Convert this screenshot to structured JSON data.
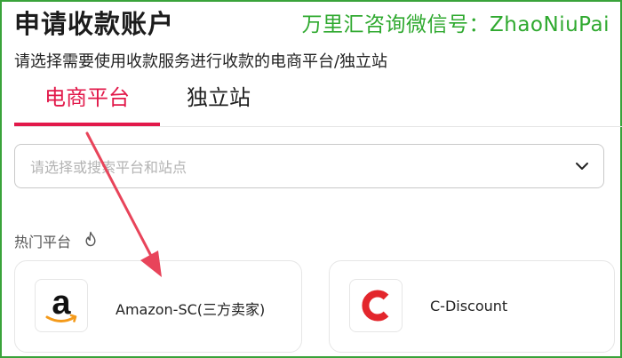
{
  "page": {
    "title": "申请收款账户",
    "subtitle": "请选择需要使用收款服务进行收款的电商平台/独立站"
  },
  "watermark": "万里汇咨询微信号：ZhaoNiuPai",
  "tabs": [
    {
      "label": "电商平台",
      "active": true
    },
    {
      "label": "独立站",
      "active": false
    }
  ],
  "search": {
    "placeholder": "请选择或搜索平台和站点",
    "value": ""
  },
  "hot_section": {
    "label": "热门平台",
    "icon": "fire-icon"
  },
  "platforms": [
    {
      "name": "Amazon-SC(三方卖家)",
      "logo": "amazon-logo"
    },
    {
      "name": "C-Discount",
      "logo": "cdiscount-logo"
    }
  ],
  "colors": {
    "accent": "#e2194a",
    "watermark": "#2fa92f",
    "frame": "#39a33a",
    "arrow": "#e8445a",
    "cdiscount_red": "#e3262c",
    "amazon_orange": "#f49a1a"
  }
}
